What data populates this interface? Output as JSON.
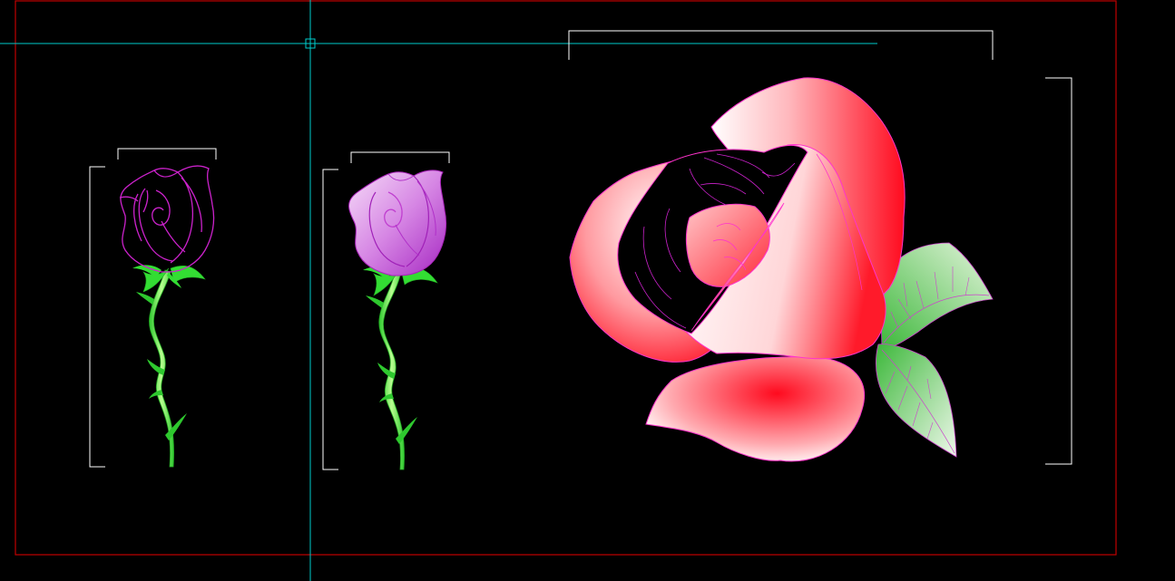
{
  "viewport": {
    "background": "#000000",
    "frame_color": "#c00000",
    "crosshair_color": "#00cccc",
    "dimension_color": "#ffffff"
  },
  "drawings": [
    {
      "name": "rose-bud-outline",
      "style": "outline",
      "petal_stroke": "#cc22cc",
      "stem_fill": "#33dd33",
      "stem_highlight": "#aaff88"
    },
    {
      "name": "rose-bud-filled",
      "style": "filled",
      "petal_light": "#f2ccf6",
      "petal_dark": "#b133cc",
      "petal_stroke": "#aa22bb",
      "stem_fill": "#33dd33",
      "stem_highlight": "#aaff88"
    },
    {
      "name": "open-rose",
      "style": "gradient",
      "petal_red": "#ff0a1e",
      "petal_white": "#ffffff",
      "petal_stroke": "#ff33cc",
      "leaf_light": "#dff2d6",
      "leaf_dark": "#3db83b"
    }
  ]
}
